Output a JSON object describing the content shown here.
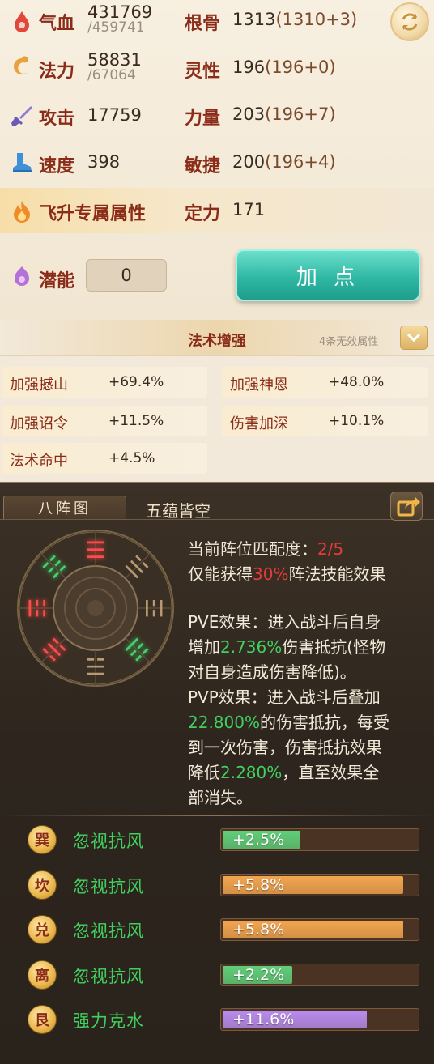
{
  "stats": {
    "hp": {
      "label": "气血",
      "value": "431769",
      "max": "/459741"
    },
    "mp": {
      "label": "法力",
      "value": "58831",
      "max": "/67064"
    },
    "attack": {
      "label": "攻击",
      "value": "17759"
    },
    "speed": {
      "label": "速度",
      "value": "398"
    },
    "ascend": {
      "label": "飞升专属属性"
    },
    "potential": {
      "label": "潜能",
      "value": "0"
    }
  },
  "attributes": {
    "gengu": {
      "label": "根骨",
      "value": "1313",
      "detail": "(1310+3)"
    },
    "lingxing": {
      "label": "灵性",
      "value": "196",
      "detail": "(196+0)"
    },
    "liliang": {
      "label": "力量",
      "value": "203",
      "detail": "(196+7)"
    },
    "minjie": {
      "label": "敏捷",
      "value": "200",
      "detail": "(196+4)"
    },
    "dingli": {
      "label": "定力",
      "value": "171"
    }
  },
  "add_points_label": "加 点",
  "spell_enhance": {
    "title": "法术增强",
    "invalid_note": "4条无效属性",
    "items": [
      {
        "name": "加强撼山",
        "value": "+69.4%"
      },
      {
        "name": "加强神恩",
        "value": "+48.0%"
      },
      {
        "name": "加强诏令",
        "value": "+11.5%"
      },
      {
        "name": "伤害加深",
        "value": "+10.1%"
      },
      {
        "name": "法术命中",
        "value": "+4.5%"
      }
    ]
  },
  "formation": {
    "tab_label": "八阵图",
    "name": "五蕴皆空",
    "match_prefix": "当前阵位匹配度：",
    "match_value": "2/5",
    "gain_prefix": "仅能获得",
    "gain_value": "30%",
    "gain_suffix": "阵法技能效果",
    "pve_line1": "PVE效果：进入战斗后自身",
    "pve_line2_a": "增加",
    "pve_line2_value": "2.736%",
    "pve_line2_b": "伤害抵抗(怪物",
    "pve_line3": "对自身造成伤害降低)。",
    "pvp_line1": "PVP效果：进入战斗后叠加",
    "pvp_line2_value": "22.800%",
    "pvp_line2_b": "的伤害抵抗，每受",
    "pvp_line3": "到一次伤害，伤害抵抗效果",
    "pvp_line4_a": "降低",
    "pvp_line4_value": "2.280%",
    "pvp_line4_b": "，直至效果全",
    "pvp_line5": "部消失。",
    "trigrams": [
      "☰",
      "☱",
      "☲",
      "☳",
      "☴",
      "☵",
      "☶",
      "☷"
    ],
    "bonuses": [
      {
        "coin": "巽",
        "name": "忽视抗风",
        "value": "+2.5%",
        "fraction": 0.4,
        "color": "#5fcf7a"
      },
      {
        "coin": "坎",
        "name": "忽视抗风",
        "value": "+5.8%",
        "fraction": 0.93,
        "color": "#f3a64f"
      },
      {
        "coin": "兑",
        "name": "忽视抗风",
        "value": "+5.8%",
        "fraction": 0.93,
        "color": "#f3a64f"
      },
      {
        "coin": "离",
        "name": "忽视抗风",
        "value": "+2.2%",
        "fraction": 0.36,
        "color": "#5fcf7a"
      },
      {
        "coin": "艮",
        "name": "强力克水",
        "value": "+11.6%",
        "fraction": 0.74,
        "color": "#b98cf0"
      }
    ]
  }
}
